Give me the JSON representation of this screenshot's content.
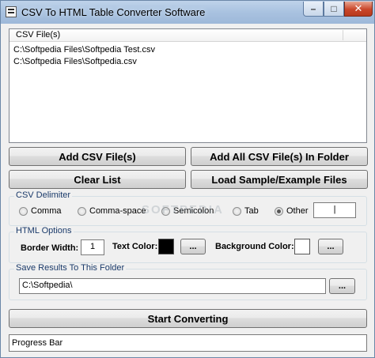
{
  "window": {
    "title": "CSV To HTML Table Converter Software",
    "app_icon": "app-icon",
    "controls": {
      "minimize": "–",
      "maximize": "□",
      "close": "✕"
    }
  },
  "file_list": {
    "header": "CSV File(s)",
    "items": [
      "C:\\Softpedia Files\\Softpedia Test.csv",
      "C:\\Softpedia Files\\Softpedia.csv"
    ]
  },
  "buttons": {
    "add_files": "Add CSV File(s)",
    "add_folder": "Add All CSV File(s) In Folder",
    "clear_list": "Clear List",
    "load_sample": "Load Sample/Example Files",
    "start": "Start Converting",
    "browse": "..."
  },
  "csv_delimiter": {
    "label": "CSV Delimiter",
    "options": [
      "Comma",
      "Comma-space",
      "Semicolon",
      "Tab",
      "Other"
    ],
    "selected": "Other",
    "other_value": "|"
  },
  "html_options": {
    "label": "HTML Options",
    "border_width_label": "Border Width:",
    "border_width_value": "1",
    "text_color_label": "Text Color:",
    "text_color": "#000000",
    "background_color_label": "Background Color:",
    "background_color": "#ffffff"
  },
  "save_results": {
    "label": "Save Results To This Folder",
    "path": "C:\\Softpedia\\"
  },
  "progress": {
    "label": "Progress Bar",
    "value": 0
  },
  "watermark": "SOFTPEDIA"
}
